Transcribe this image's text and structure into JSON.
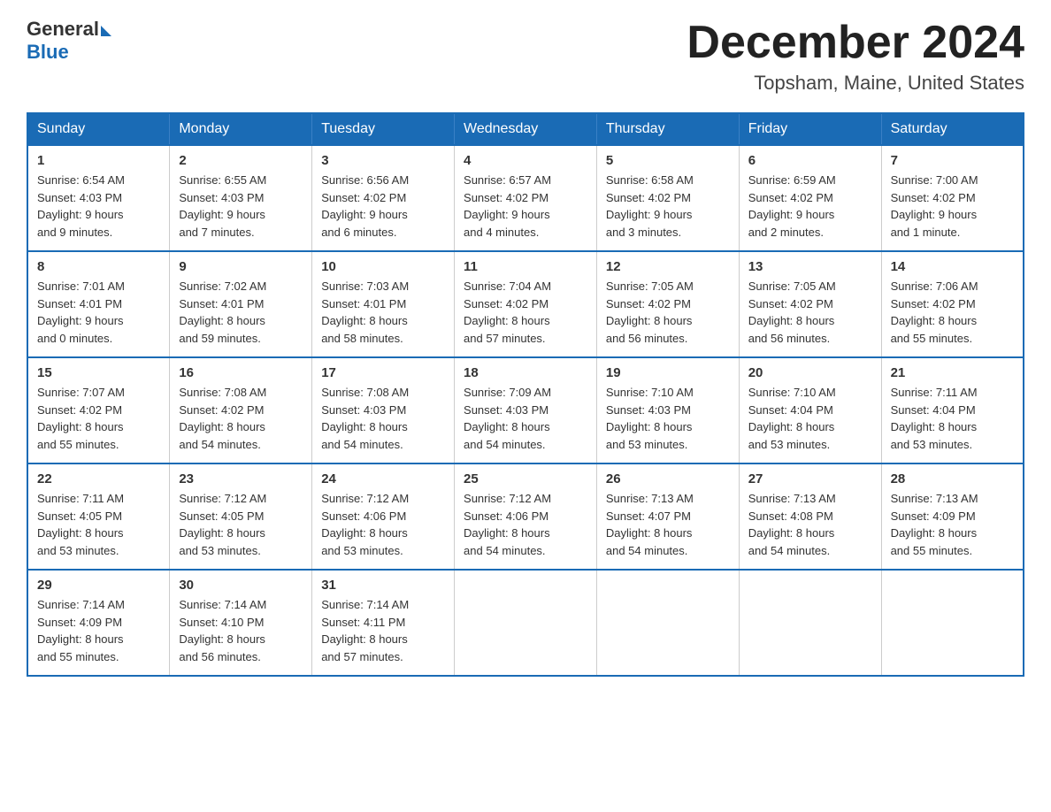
{
  "header": {
    "logo_general": "General",
    "logo_blue": "Blue",
    "month_title": "December 2024",
    "location": "Topsham, Maine, United States"
  },
  "days_of_week": [
    "Sunday",
    "Monday",
    "Tuesday",
    "Wednesday",
    "Thursday",
    "Friday",
    "Saturday"
  ],
  "weeks": [
    [
      {
        "day": "1",
        "sunrise": "6:54 AM",
        "sunset": "4:03 PM",
        "daylight": "9 hours and 9 minutes."
      },
      {
        "day": "2",
        "sunrise": "6:55 AM",
        "sunset": "4:03 PM",
        "daylight": "9 hours and 7 minutes."
      },
      {
        "day": "3",
        "sunrise": "6:56 AM",
        "sunset": "4:02 PM",
        "daylight": "9 hours and 6 minutes."
      },
      {
        "day": "4",
        "sunrise": "6:57 AM",
        "sunset": "4:02 PM",
        "daylight": "9 hours and 4 minutes."
      },
      {
        "day": "5",
        "sunrise": "6:58 AM",
        "sunset": "4:02 PM",
        "daylight": "9 hours and 3 minutes."
      },
      {
        "day": "6",
        "sunrise": "6:59 AM",
        "sunset": "4:02 PM",
        "daylight": "9 hours and 2 minutes."
      },
      {
        "day": "7",
        "sunrise": "7:00 AM",
        "sunset": "4:02 PM",
        "daylight": "9 hours and 1 minute."
      }
    ],
    [
      {
        "day": "8",
        "sunrise": "7:01 AM",
        "sunset": "4:01 PM",
        "daylight": "9 hours and 0 minutes."
      },
      {
        "day": "9",
        "sunrise": "7:02 AM",
        "sunset": "4:01 PM",
        "daylight": "8 hours and 59 minutes."
      },
      {
        "day": "10",
        "sunrise": "7:03 AM",
        "sunset": "4:01 PM",
        "daylight": "8 hours and 58 minutes."
      },
      {
        "day": "11",
        "sunrise": "7:04 AM",
        "sunset": "4:02 PM",
        "daylight": "8 hours and 57 minutes."
      },
      {
        "day": "12",
        "sunrise": "7:05 AM",
        "sunset": "4:02 PM",
        "daylight": "8 hours and 56 minutes."
      },
      {
        "day": "13",
        "sunrise": "7:05 AM",
        "sunset": "4:02 PM",
        "daylight": "8 hours and 56 minutes."
      },
      {
        "day": "14",
        "sunrise": "7:06 AM",
        "sunset": "4:02 PM",
        "daylight": "8 hours and 55 minutes."
      }
    ],
    [
      {
        "day": "15",
        "sunrise": "7:07 AM",
        "sunset": "4:02 PM",
        "daylight": "8 hours and 55 minutes."
      },
      {
        "day": "16",
        "sunrise": "7:08 AM",
        "sunset": "4:02 PM",
        "daylight": "8 hours and 54 minutes."
      },
      {
        "day": "17",
        "sunrise": "7:08 AM",
        "sunset": "4:03 PM",
        "daylight": "8 hours and 54 minutes."
      },
      {
        "day": "18",
        "sunrise": "7:09 AM",
        "sunset": "4:03 PM",
        "daylight": "8 hours and 54 minutes."
      },
      {
        "day": "19",
        "sunrise": "7:10 AM",
        "sunset": "4:03 PM",
        "daylight": "8 hours and 53 minutes."
      },
      {
        "day": "20",
        "sunrise": "7:10 AM",
        "sunset": "4:04 PM",
        "daylight": "8 hours and 53 minutes."
      },
      {
        "day": "21",
        "sunrise": "7:11 AM",
        "sunset": "4:04 PM",
        "daylight": "8 hours and 53 minutes."
      }
    ],
    [
      {
        "day": "22",
        "sunrise": "7:11 AM",
        "sunset": "4:05 PM",
        "daylight": "8 hours and 53 minutes."
      },
      {
        "day": "23",
        "sunrise": "7:12 AM",
        "sunset": "4:05 PM",
        "daylight": "8 hours and 53 minutes."
      },
      {
        "day": "24",
        "sunrise": "7:12 AM",
        "sunset": "4:06 PM",
        "daylight": "8 hours and 53 minutes."
      },
      {
        "day": "25",
        "sunrise": "7:12 AM",
        "sunset": "4:06 PM",
        "daylight": "8 hours and 54 minutes."
      },
      {
        "day": "26",
        "sunrise": "7:13 AM",
        "sunset": "4:07 PM",
        "daylight": "8 hours and 54 minutes."
      },
      {
        "day": "27",
        "sunrise": "7:13 AM",
        "sunset": "4:08 PM",
        "daylight": "8 hours and 54 minutes."
      },
      {
        "day": "28",
        "sunrise": "7:13 AM",
        "sunset": "4:09 PM",
        "daylight": "8 hours and 55 minutes."
      }
    ],
    [
      {
        "day": "29",
        "sunrise": "7:14 AM",
        "sunset": "4:09 PM",
        "daylight": "8 hours and 55 minutes."
      },
      {
        "day": "30",
        "sunrise": "7:14 AM",
        "sunset": "4:10 PM",
        "daylight": "8 hours and 56 minutes."
      },
      {
        "day": "31",
        "sunrise": "7:14 AM",
        "sunset": "4:11 PM",
        "daylight": "8 hours and 57 minutes."
      },
      null,
      null,
      null,
      null
    ]
  ],
  "labels": {
    "sunrise": "Sunrise:",
    "sunset": "Sunset:",
    "daylight": "Daylight:"
  }
}
